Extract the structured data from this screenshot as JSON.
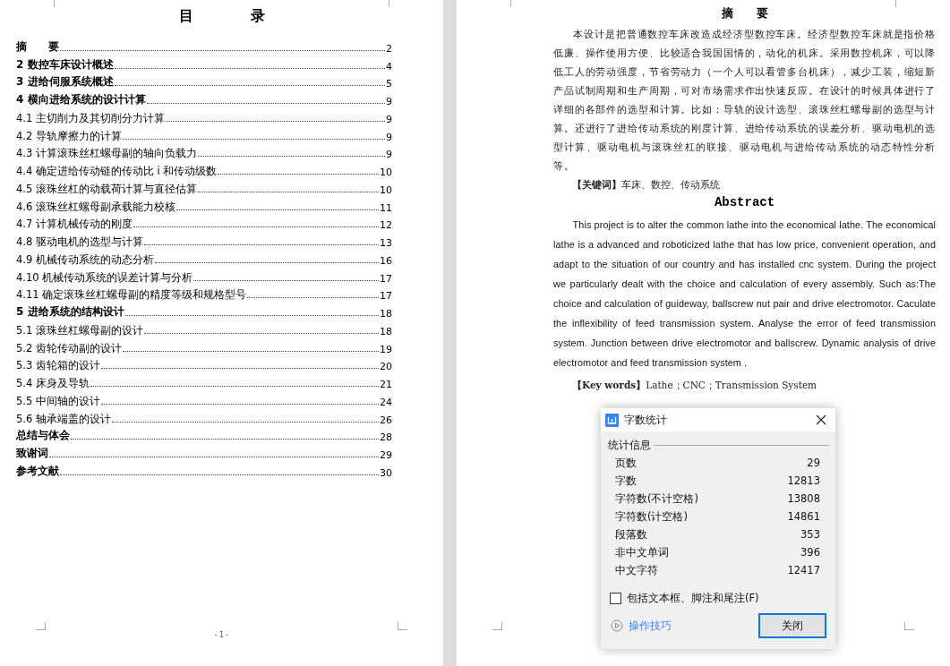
{
  "toc": {
    "title": "目　　　　录",
    "entries": [
      {
        "kind": "chapter",
        "label": "摘　　要",
        "page": "2"
      },
      {
        "kind": "chapter",
        "label": "2 数控车床设计概述",
        "page": "4"
      },
      {
        "kind": "chapter",
        "label": "3 进给伺服系统概述",
        "page": "5"
      },
      {
        "kind": "chapter",
        "label": "4 横向进给系统的设计计算",
        "page": "9"
      },
      {
        "kind": "section",
        "label": "4.1 主切削力及其切削分力计算",
        "page": "9"
      },
      {
        "kind": "section",
        "label": "4.2 导轨摩擦力的计算",
        "page": "9"
      },
      {
        "kind": "section",
        "label": "4.3 计算滚珠丝杠螺母副的轴向负载力",
        "page": "9"
      },
      {
        "kind": "section",
        "label": "4.4 确定进给传动链的传动比 i 和传动级数",
        "page": "10"
      },
      {
        "kind": "section",
        "label": "4.5 滚珠丝杠的动载荷计算与直径估算",
        "page": "10"
      },
      {
        "kind": "section",
        "label": "4.6 滚珠丝杠螺母副承载能力校核",
        "page": "11"
      },
      {
        "kind": "section",
        "label": "4.7 计算机械传动的刚度",
        "page": "12"
      },
      {
        "kind": "section",
        "label": "4.8 驱动电机的选型与计算",
        "page": "13"
      },
      {
        "kind": "section",
        "label": "4.9 机械传动系统的动态分析",
        "page": "16"
      },
      {
        "kind": "section",
        "label": "4.10 机械传动系统的误差计算与分析",
        "page": "17"
      },
      {
        "kind": "section",
        "label": "4.11 确定滚珠丝杠螺母副的精度等级和规格型号",
        "page": "17"
      },
      {
        "kind": "chapter",
        "label": "5 进给系统的结构设计",
        "page": "18"
      },
      {
        "kind": "section",
        "label": "5.1 滚珠丝杠螺母副的设计",
        "page": "18"
      },
      {
        "kind": "section",
        "label": "5.2 齿轮传动副的设计",
        "page": "19"
      },
      {
        "kind": "section",
        "label": "5.3 齿轮箱的设计",
        "page": "20"
      },
      {
        "kind": "section",
        "label": "5.4 床身及导轨",
        "page": "21"
      },
      {
        "kind": "section",
        "label": "5.5 中间轴的设计",
        "page": "24"
      },
      {
        "kind": "section",
        "label": "5.6 轴承端盖的设计",
        "page": "26"
      },
      {
        "kind": "chapter",
        "label": "总结与体会",
        "page": "28"
      },
      {
        "kind": "chapter",
        "label": "致谢词",
        "page": "29"
      },
      {
        "kind": "chapter",
        "label": "参考文献",
        "page": "30"
      }
    ],
    "page_number": "- 1 -"
  },
  "abstract": {
    "title_zh": "摘　　要",
    "body_zh": "本设计是把普通数控车床改造成经济型数控车床。经济型数控车床就是指价格低廉、操作使用方便、比较适合我国国情的，动化的机床。采用数控机床，可以降低工人的劳动强度，节省劳动力（一个人可以看管多台机床），减少工装，缩短新产品试制周期和生产周期，可对市场需求作出快速反应。在设计的时候具体进行了详细的各部件的选型和计算。比如：导轨的设计选型、滚珠丝杠螺母副的选型与计算。还进行了进给传动系统的刚度计算、进给传动系统的误差分析、驱动电机的选型计算、驱动电机与滚珠丝杠的联接、驱动电机与进给传动系统的动态特性分析等。",
    "keywords_zh": "**【关键词】**车床、数控、传动系统",
    "title_en": "Abstract",
    "body_en": "This project is to alter the common lathe into the economical lathe. The economical lathe is a advanced and roboticized lathe that has low price, convenient operation, and adapt to the situation of our country and has installed cnc system. During the project we particularly dealt with the choice and calculation of every assembly. Such as:The choice and calculation of guideway, ballscrew nut pair and drive electromotor. Caculate the inflexibility of feed transmission system. Analyse the error of feed transmission system. Junction between drive electromotor and ballscrew. Dynamic analysis of drive electromotor and feed transmission system .",
    "keywords_en": "**【Key words】**Lathe；CNC；Transmission System"
  },
  "dialog": {
    "title": "字数统计",
    "section": "统计信息",
    "stats": [
      {
        "label": "页数",
        "value": "29"
      },
      {
        "label": "字数",
        "value": "12813"
      },
      {
        "label": "字符数(不计空格)",
        "value": "13808"
      },
      {
        "label": "字符数(计空格)",
        "value": "14861"
      },
      {
        "label": "段落数",
        "value": "353"
      },
      {
        "label": "非中文单词",
        "value": "396"
      },
      {
        "label": "中文字符",
        "value": "12417"
      }
    ],
    "checkbox": {
      "label": "包括文本框、脚注和尾注(F)",
      "checked": false
    },
    "link": "操作技巧",
    "button": "关闭"
  }
}
